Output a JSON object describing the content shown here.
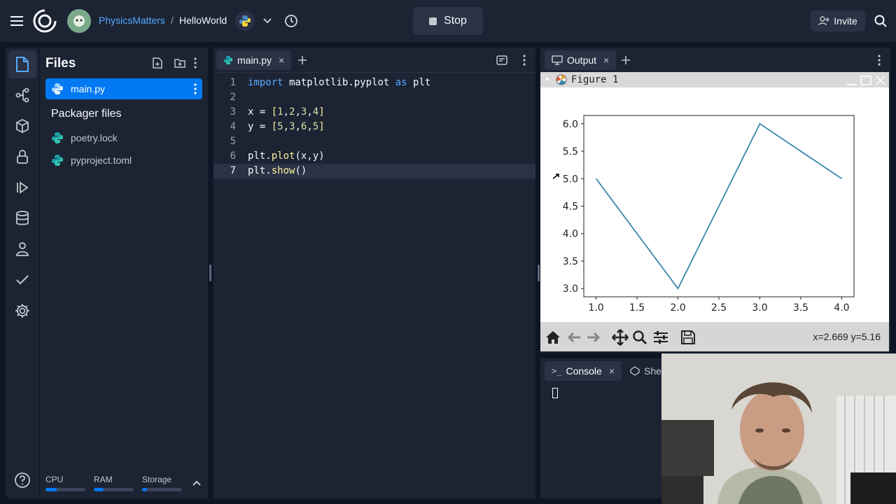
{
  "header": {
    "team": "PhysicsMatters",
    "separator": "/",
    "repl_name": "HelloWorld",
    "run_button": "Stop",
    "invite_button": "Invite"
  },
  "sidebar_rail": {
    "icons": [
      "files-icon",
      "git-icon",
      "packages-icon",
      "secrets-icon",
      "run-icon",
      "database-icon",
      "user-icon",
      "check-icon",
      "settings-icon",
      "help-icon"
    ]
  },
  "files": {
    "title": "Files",
    "items": [
      {
        "label": "main.py",
        "selected": true
      }
    ],
    "packager_header": "Packager files",
    "packager_items": [
      {
        "label": "poetry.lock"
      },
      {
        "label": "pyproject.toml"
      }
    ],
    "resources": {
      "cpu_label": "CPU",
      "cpu_level": 0.28,
      "ram_label": "RAM",
      "ram_level": 0.25,
      "storage_label": "Storage",
      "storage_level": 0.12
    }
  },
  "editor": {
    "tab_label": "main.py",
    "tab_close": "×",
    "lines": [
      {
        "n": "1",
        "text": "import matplotlib.pyplot as plt"
      },
      {
        "n": "2",
        "text": ""
      },
      {
        "n": "3",
        "text": "x = [1,2,3,4]"
      },
      {
        "n": "4",
        "text": "y = [5,3,6,5]"
      },
      {
        "n": "5",
        "text": ""
      },
      {
        "n": "6",
        "text": "plt.plot(x,y)"
      },
      {
        "n": "7",
        "text": "plt.show()"
      }
    ]
  },
  "output": {
    "tab_label": "Output",
    "tab_close": "×",
    "figure_title": "Figure 1",
    "coord_readout": "x=2.669 y=5.16"
  },
  "console": {
    "tab_label": "Console",
    "tab_close": "×",
    "shell_tab": "Shell"
  },
  "chart_data": {
    "type": "line",
    "x": [
      1,
      2,
      3,
      4
    ],
    "series": [
      {
        "values": [
          5,
          3,
          6,
          5
        ]
      }
    ],
    "xlim": [
      0.85,
      4.15
    ],
    "ylim": [
      2.85,
      6.15
    ],
    "xticks": [
      "1.0",
      "1.5",
      "2.0",
      "2.5",
      "3.0",
      "3.5",
      "4.0"
    ],
    "yticks": [
      "3.0",
      "3.5",
      "4.0",
      "4.5",
      "5.0",
      "5.5",
      "6.0"
    ],
    "title": "",
    "xlabel": "",
    "ylabel": "",
    "line_color": "#3a86ad",
    "grid": false
  }
}
